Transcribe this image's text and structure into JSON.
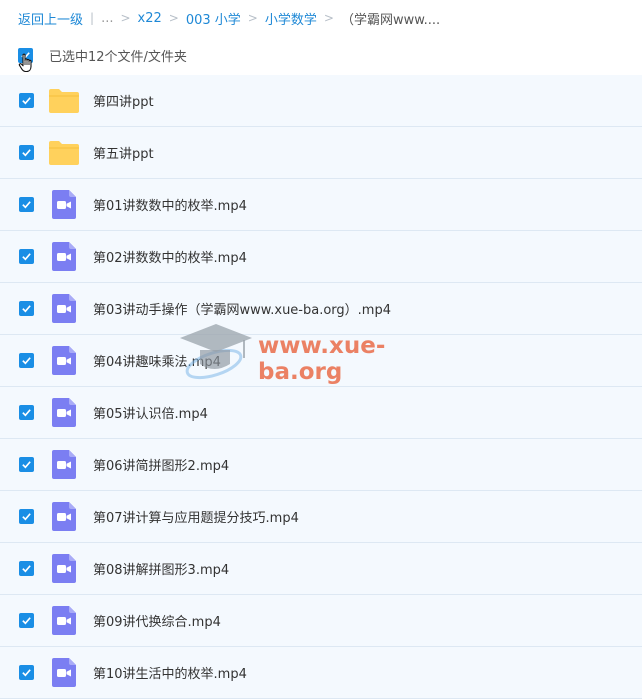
{
  "breadcrumb": {
    "back_label": "返回上一级",
    "ellipsis": "...",
    "crumbs": [
      "x22",
      "003 小学",
      "小学数学"
    ],
    "current": "（学霸网www...."
  },
  "selection": {
    "text": "已选中12个文件/文件夹",
    "checked": true
  },
  "files": [
    {
      "name": "第四讲ppt",
      "type": "folder",
      "checked": true
    },
    {
      "name": "第五讲ppt",
      "type": "folder",
      "checked": true
    },
    {
      "name": "第01讲数数中的枚举.mp4",
      "type": "video",
      "checked": true
    },
    {
      "name": "第02讲数数中的枚举.mp4",
      "type": "video",
      "checked": true
    },
    {
      "name": "第03讲动手操作（学霸网www.xue-ba.org）.mp4",
      "type": "video",
      "checked": true
    },
    {
      "name": "第04讲趣味乘法.mp4",
      "type": "video",
      "checked": true
    },
    {
      "name": "第05讲认识倍.mp4",
      "type": "video",
      "checked": true
    },
    {
      "name": "第06讲简拼图形2.mp4",
      "type": "video",
      "checked": true
    },
    {
      "name": "第07讲计算与应用题提分技巧.mp4",
      "type": "video",
      "checked": true
    },
    {
      "name": "第08讲解拼图形3.mp4",
      "type": "video",
      "checked": true
    },
    {
      "name": "第09讲代换综合.mp4",
      "type": "video",
      "checked": true
    },
    {
      "name": "第10讲生活中的枚举.mp4",
      "type": "video",
      "checked": true
    }
  ],
  "watermark": {
    "text": "www.xue-ba.org"
  },
  "colors": {
    "accent": "#1a8ee5",
    "link": "#1e88d6",
    "folder": "#ffd15c",
    "video": "#7b7ef2",
    "row_bg": "#f4f9fe",
    "row_border": "#dde8f3",
    "watermark": "#e8542a"
  }
}
